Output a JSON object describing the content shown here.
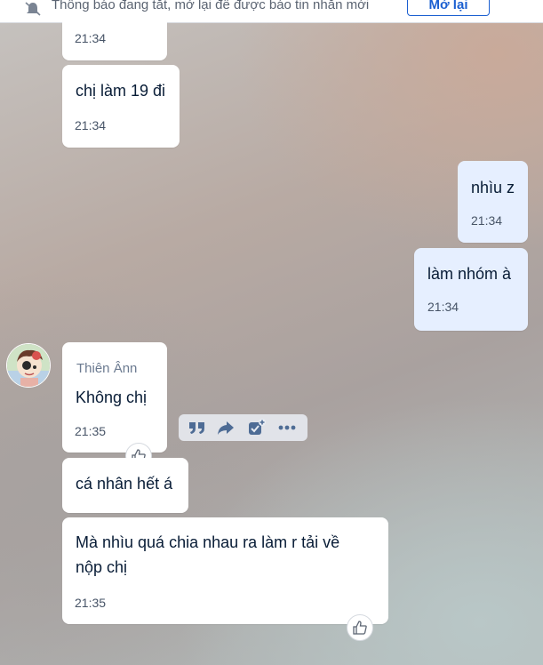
{
  "notification": {
    "text": "Thông báo đang tắt, mở lại để được báo tin nhắn mới",
    "button_label": "Mở lại"
  },
  "messages": [
    {
      "side": "left",
      "text": "",
      "time": "21:34"
    },
    {
      "side": "left",
      "text": "chị làm 19 đi",
      "time": "21:34"
    },
    {
      "side": "right",
      "text": "nhìu z",
      "time": "21:34"
    },
    {
      "side": "right",
      "text": "làm nhóm à",
      "time": "21:34"
    },
    {
      "side": "left",
      "sender": "Thiên Ânn",
      "text": "Không chị",
      "time": "21:35"
    },
    {
      "side": "left",
      "text": "cá nhân hết á",
      "time": ""
    },
    {
      "side": "left",
      "text": "Mà nhìu quá chia nhau ra làm r tải về nộp chị",
      "time": "21:35"
    }
  ],
  "message_actions": [
    "quote-icon",
    "forward-icon",
    "add-todo-icon",
    "more-icon"
  ],
  "colors": {
    "my_bubble": "#e6efff",
    "their_bubble": "#ffffff",
    "accent": "#1b5fd1",
    "action_icon": "#4e6c95"
  }
}
